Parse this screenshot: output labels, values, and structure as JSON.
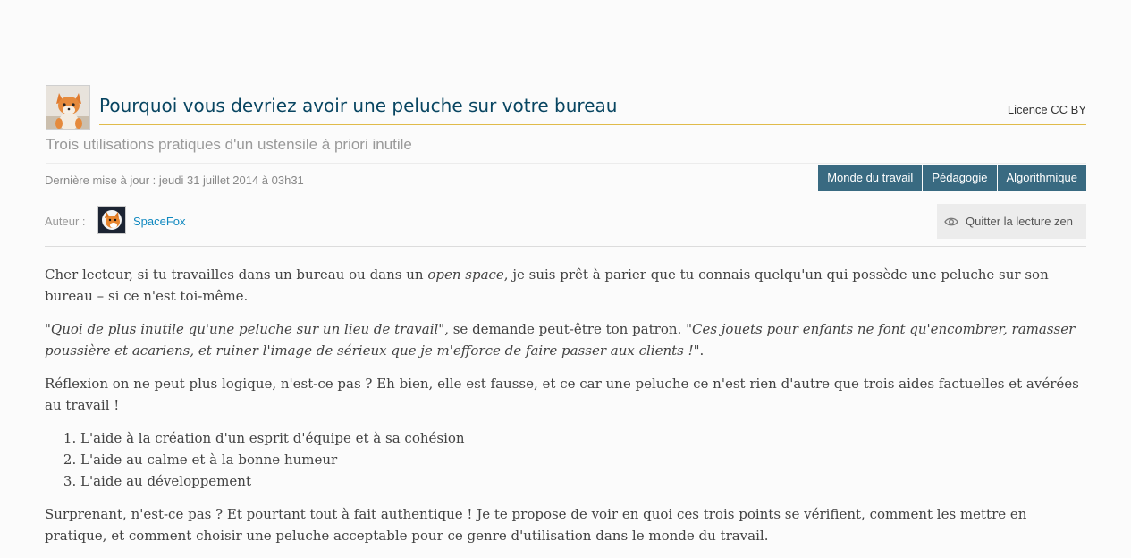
{
  "article": {
    "title": "Pourquoi vous devriez avoir une peluche sur votre bureau",
    "license": "Licence CC BY",
    "subtitle": "Trois utilisations pratiques d'un ustensile à priori inutile",
    "last_update": "Dernière mise à jour : jeudi 31 juillet 2014 à 03h31",
    "thumbnail_icon": "plush-fox-image"
  },
  "tags": [
    "Monde du travail",
    "Pédagogie",
    "Algorithmique"
  ],
  "author": {
    "label": "Auteur :",
    "name": "SpaceFox",
    "avatar_icon": "fox-avatar"
  },
  "zen_button": {
    "label": "Quitter la lecture zen",
    "icon": "eye-icon"
  },
  "body": {
    "p1": {
      "before": "Cher lecteur, si tu travailles dans un bureau ou dans un ",
      "em": "open space",
      "after": ", je suis prêt à parier que tu connais quelqu'un qui possède une peluche sur son bureau – si ce n'est toi-même."
    },
    "p2": {
      "quote1": "\"Quoi de plus inutile qu'une peluche sur un lieu de travail\"",
      "middle": ", se demande peut-être ton patron. ",
      "quote2": "\"Ces jouets pour enfants ne font qu'encombrer, ramasser poussière et acariens, et ruiner l'image de sérieux que je m'efforce de faire passer aux clients !\"",
      "end": "."
    },
    "p3": "Réflexion on ne peut plus logique, n'est-ce pas ? Eh bien, elle est fausse, et ce car une peluche ce n'est rien d'autre que trois aides factuelles et avérées au travail !",
    "list": [
      "L'aide à la création d'un esprit d'équipe et à sa cohésion",
      "L'aide au calme et à la bonne humeur",
      "L'aide au développement"
    ],
    "p4": "Surprenant, n'est-ce pas ? Et pourtant tout à fait authentique ! Je te propose de voir en quoi ces trois points se vérifient, comment les mettre en pratique, et comment choisir une peluche acceptable pour ce genre d'utilisation dans le monde du travail."
  },
  "colors": {
    "title": "#084561",
    "title_underline": "#e0bb4a",
    "tag_bg": "#396a81",
    "author_link": "#1088bf"
  }
}
